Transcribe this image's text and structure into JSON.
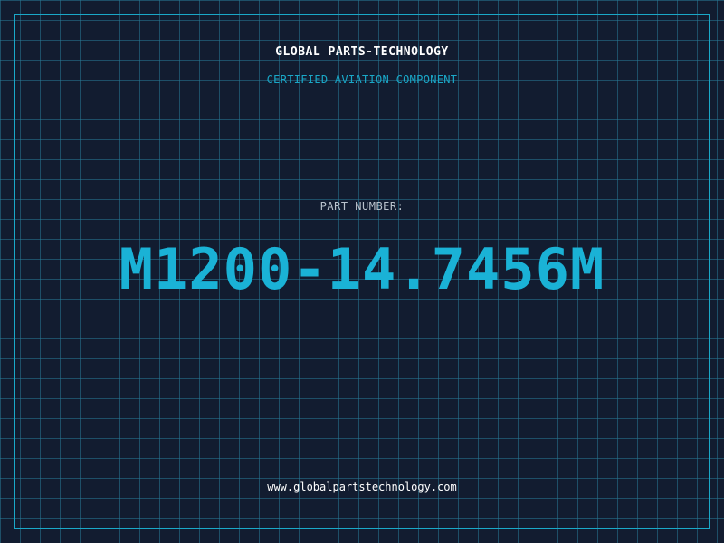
{
  "header": {
    "company": "GLOBAL PARTS-TECHNOLOGY",
    "tagline": "CERTIFIED AVIATION COMPONENT"
  },
  "part": {
    "label": "PART NUMBER:",
    "number": "M1200-14.7456M"
  },
  "footer": {
    "url": "www.globalpartstechnology.com"
  },
  "colors": {
    "background": "#121c30",
    "grid": "#287896",
    "accent": "#1ab2d6",
    "border": "#1aa8c8"
  }
}
